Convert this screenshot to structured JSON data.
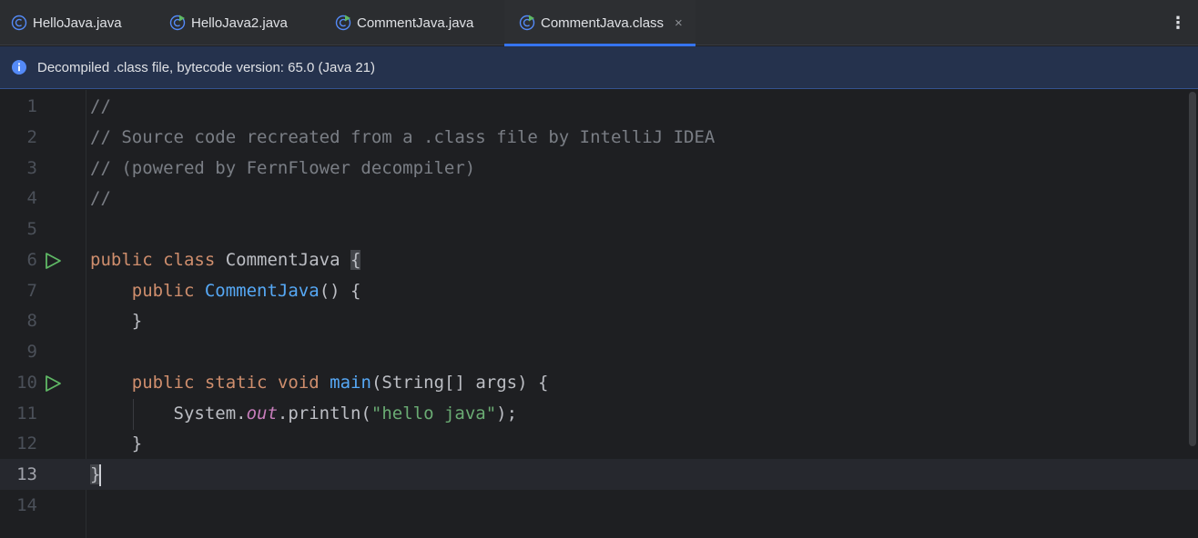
{
  "tabs": [
    {
      "label": "HelloJava.java",
      "icon": "class-icon"
    },
    {
      "label": "HelloJava2.java",
      "icon": "class-runnable-icon"
    },
    {
      "label": "CommentJava.java",
      "icon": "class-runnable-icon"
    },
    {
      "label": "CommentJava.class",
      "icon": "class-runnable-icon",
      "active": true,
      "close": "×"
    }
  ],
  "tab_menu": "⋮",
  "banner": {
    "icon": "info-icon",
    "text": "Decompiled .class file, bytecode version: 65.0 (Java 21)"
  },
  "editor": {
    "current_line": 13,
    "lines": [
      {
        "n": "1",
        "text": "//"
      },
      {
        "n": "2",
        "text": "// Source code recreated from a .class file by IntelliJ IDEA"
      },
      {
        "n": "3",
        "text": "// (powered by FernFlower decompiler)"
      },
      {
        "n": "4",
        "text": "//"
      },
      {
        "n": "5",
        "text": ""
      },
      {
        "n": "6",
        "text": "public class CommentJava {",
        "run": true
      },
      {
        "n": "7",
        "text": "    public CommentJava() {"
      },
      {
        "n": "8",
        "text": "    }"
      },
      {
        "n": "9",
        "text": ""
      },
      {
        "n": "10",
        "text": "    public static void main(String[] args) {",
        "run": true
      },
      {
        "n": "11",
        "text": "        System.out.println(\"hello java\");"
      },
      {
        "n": "12",
        "text": "    }"
      },
      {
        "n": "13",
        "text": "}"
      },
      {
        "n": "14",
        "text": ""
      }
    ]
  },
  "colors": {
    "accent": "#3574f0",
    "keyword": "#cf8e6d",
    "comment": "#7a7e85",
    "function": "#56a8f5",
    "string": "#6aab73",
    "static_field": "#c77dbb",
    "run_icon": "#5fb865"
  }
}
